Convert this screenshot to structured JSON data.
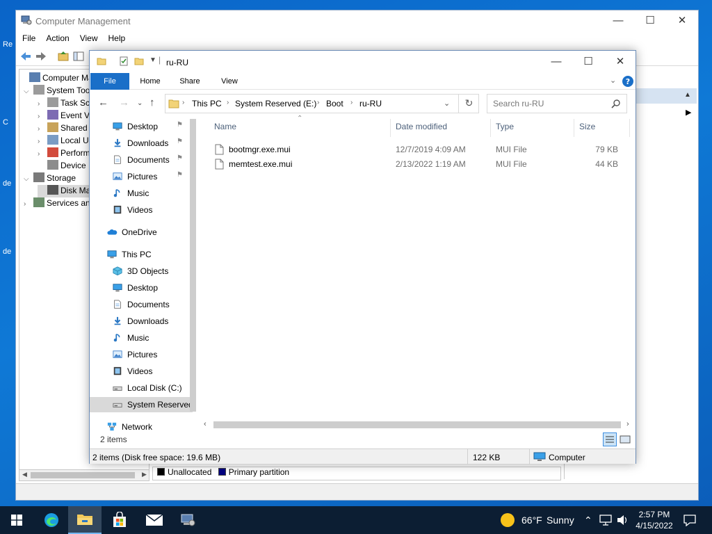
{
  "desktop": {
    "stub_texts": [
      "Re",
      "C",
      "de",
      "de"
    ]
  },
  "cm": {
    "title": "Computer Management",
    "menu": [
      "File",
      "Action",
      "View",
      "Help"
    ],
    "tree": [
      {
        "label": "Computer Mana",
        "expander": ""
      },
      {
        "label": "System Too",
        "expander": "v"
      },
      {
        "label": "Task Sch",
        "expander": ">"
      },
      {
        "label": "Event V",
        "expander": ">"
      },
      {
        "label": "Shared",
        "expander": ">"
      },
      {
        "label": "Local U",
        "expander": ">"
      },
      {
        "label": "Perform",
        "expander": ">"
      },
      {
        "label": "Device I",
        "expander": ""
      },
      {
        "label": "Storage",
        "expander": "v"
      },
      {
        "label": "Disk Ma",
        "expander": ""
      },
      {
        "label": "Services an",
        "expander": ">"
      }
    ],
    "legend": {
      "unallocated": "Unallocated",
      "primary": "Primary partition"
    },
    "colors": {
      "unallocated": "#000000",
      "primary": "#000080"
    }
  },
  "fe": {
    "title": "ru-RU",
    "ribbon_tabs": [
      "File",
      "Home",
      "Share",
      "View"
    ],
    "breadcrumb": [
      "This PC",
      "System Reserved (E:)",
      "Boot",
      "ru-RU"
    ],
    "search_placeholder": "Search ru-RU",
    "nav": {
      "quick": [
        {
          "label": "Desktop",
          "icon": "desktop-icon",
          "pinned": true
        },
        {
          "label": "Downloads",
          "icon": "download-icon",
          "pinned": true
        },
        {
          "label": "Documents",
          "icon": "document-icon",
          "pinned": true
        },
        {
          "label": "Pictures",
          "icon": "pictures-icon",
          "pinned": true
        },
        {
          "label": "Music",
          "icon": "music-icon",
          "pinned": false
        },
        {
          "label": "Videos",
          "icon": "video-icon",
          "pinned": false
        }
      ],
      "onedrive": "OneDrive",
      "thispc": "This PC",
      "pc_items": [
        {
          "label": "3D Objects",
          "icon": "cube-icon"
        },
        {
          "label": "Desktop",
          "icon": "desktop-icon"
        },
        {
          "label": "Documents",
          "icon": "document-icon"
        },
        {
          "label": "Downloads",
          "icon": "download-icon"
        },
        {
          "label": "Music",
          "icon": "music-icon"
        },
        {
          "label": "Pictures",
          "icon": "pictures-icon"
        },
        {
          "label": "Videos",
          "icon": "video-icon"
        },
        {
          "label": "Local Disk (C:)",
          "icon": "drive-icon"
        },
        {
          "label": "System Reserved",
          "icon": "drive-icon"
        }
      ],
      "network": "Network"
    },
    "columns": {
      "name": "Name",
      "date": "Date modified",
      "type": "Type",
      "size": "Size"
    },
    "files": [
      {
        "name": "bootmgr.exe.mui",
        "date": "12/7/2019 4:09 AM",
        "type": "MUI File",
        "size": "79 KB"
      },
      {
        "name": "memtest.exe.mui",
        "date": "2/13/2022 1:19 AM",
        "type": "MUI File",
        "size": "44 KB"
      }
    ],
    "item_count": "2 items",
    "status": {
      "left": "2 items (Disk free space: 19.6 MB)",
      "mid": "122 KB",
      "right": "Computer"
    }
  },
  "taskbar": {
    "weather": {
      "temp": "66°F",
      "cond": "Sunny"
    },
    "time": "2:57 PM",
    "date": "4/15/2022",
    "accent": "#75b7f0"
  }
}
